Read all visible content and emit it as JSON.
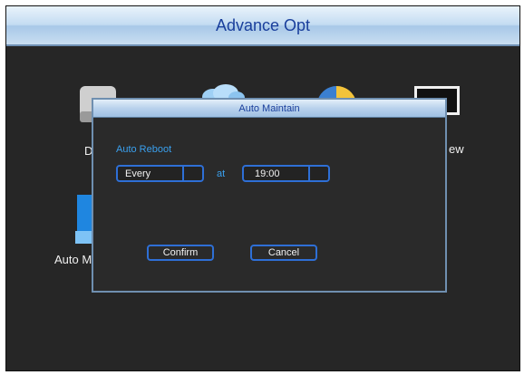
{
  "window": {
    "title": "Advance Opt"
  },
  "background": {
    "labels": {
      "left_top": "D",
      "right_top": "ew",
      "left_bottom": "Auto M"
    },
    "icons": [
      "hard-disk-icon",
      "cloud-icon",
      "pie-chart-icon",
      "monitor-icon",
      "blue-screen-icon"
    ]
  },
  "dialog": {
    "title": "Auto Maintain",
    "section_label": "Auto Reboot",
    "frequency": {
      "value": "Every"
    },
    "at_label": "at",
    "time": {
      "value": "19:00"
    },
    "confirm_label": "Confirm",
    "cancel_label": "Cancel"
  },
  "colors": {
    "accent_blue": "#2e6fd6",
    "label_blue": "#3aa0ee",
    "title_text": "#1a3f9c",
    "window_bg": "#262626"
  }
}
